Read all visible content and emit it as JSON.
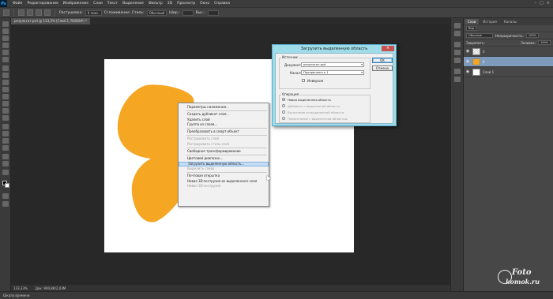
{
  "app": {
    "logo": "Ps"
  },
  "menubar": {
    "items": [
      "Файл",
      "Редактирование",
      "Изображение",
      "Слои",
      "Текст",
      "Выделение",
      "Фильтр",
      "3D",
      "Просмотр",
      "Окно",
      "Справка"
    ],
    "window_controls": [
      "–",
      "□",
      "×"
    ]
  },
  "options": {
    "feather_label": "Растушевка:",
    "feather_value": "0 пикс.",
    "smooth_label": "Сглаживание",
    "style_label": "Стиль:",
    "style_value": "Обычный",
    "width_label": "Шир.:",
    "height_label": "Выс.:"
  },
  "document": {
    "tab_title": "результат.psd @ 133,3% (Слой 2, RGB/8#) *"
  },
  "status": {
    "zoom": "133,33%",
    "doc_info": "Док: 900,8K/2,03M",
    "bottom_label": "Шкала времени"
  },
  "layers_panel": {
    "tabs": [
      "Слои",
      "История",
      "Каналы"
    ],
    "kind_label": "Вид",
    "blend_mode": "Обычные",
    "opacity_label": "Непрозрачность:",
    "opacity_value": "100%",
    "lock_label": "Закрепить:",
    "fill_label": "Заливка:",
    "fill_value": "100%",
    "layers": [
      {
        "name": "3",
        "thumb": "checker",
        "selected": false
      },
      {
        "name": "2",
        "thumb": "orange",
        "selected": true
      },
      {
        "name": "Слой 1",
        "thumb": "white",
        "selected": false
      }
    ]
  },
  "context_menu": {
    "items": [
      {
        "label": "Параметры наложения...",
        "disabled": false
      },
      {
        "sep": true
      },
      {
        "label": "Создать дубликат слоя...",
        "disabled": false
      },
      {
        "label": "Удалить слой",
        "disabled": false
      },
      {
        "label": "Группа из слоев...",
        "disabled": false
      },
      {
        "sep": true
      },
      {
        "label": "Преобразовать в смарт-объект",
        "disabled": false
      },
      {
        "sep": true
      },
      {
        "label": "Растрировать слой",
        "disabled": true
      },
      {
        "label": "Растрировать стиль слоя",
        "disabled": true
      },
      {
        "sep": true
      },
      {
        "label": "Свободное трансформирование",
        "disabled": false
      },
      {
        "sep": true
      },
      {
        "label": "Цветовой диапазон...",
        "disabled": false
      },
      {
        "label": "Загрузить выделенную область...",
        "disabled": false,
        "highlight": true
      },
      {
        "label": "Выделить слева",
        "disabled": true
      },
      {
        "sep": true
      },
      {
        "label": "Почтовая открытка",
        "disabled": false
      },
      {
        "label": "Новая 3D-экструзия из выделенного слоя",
        "disabled": false
      },
      {
        "label": "Новая 3D-экструзия",
        "disabled": true
      }
    ]
  },
  "dialog": {
    "title": "Загрузить выделенную область",
    "source_group": "Источник",
    "document_label": "Документ:",
    "document_value": "результат.psd",
    "channel_label": "Канал:",
    "channel_value": "Прозрачность 1",
    "invert_label": "Инверсия",
    "operation_group": "Операция",
    "operations": [
      {
        "label": "Новая выделенная область",
        "checked": true,
        "disabled": false
      },
      {
        "label": "Добавить к выделенной области",
        "checked": false,
        "disabled": true
      },
      {
        "label": "Вычитание из выделенной области",
        "checked": false,
        "disabled": true
      },
      {
        "label": "Пересечение с выделенной областью",
        "checked": false,
        "disabled": true
      }
    ],
    "ok_label": "OK",
    "cancel_label": "Отмена"
  },
  "watermark": {
    "line1": "Foto",
    "line2": "komok.ru"
  },
  "colors": {
    "butterfly": "#f5a623",
    "accent": "#7e9bbd"
  },
  "icons": [
    "close-icon",
    "eye-icon",
    "dropdown-arrow-icon",
    "ps-logo-icon",
    "cursor-icon"
  ]
}
